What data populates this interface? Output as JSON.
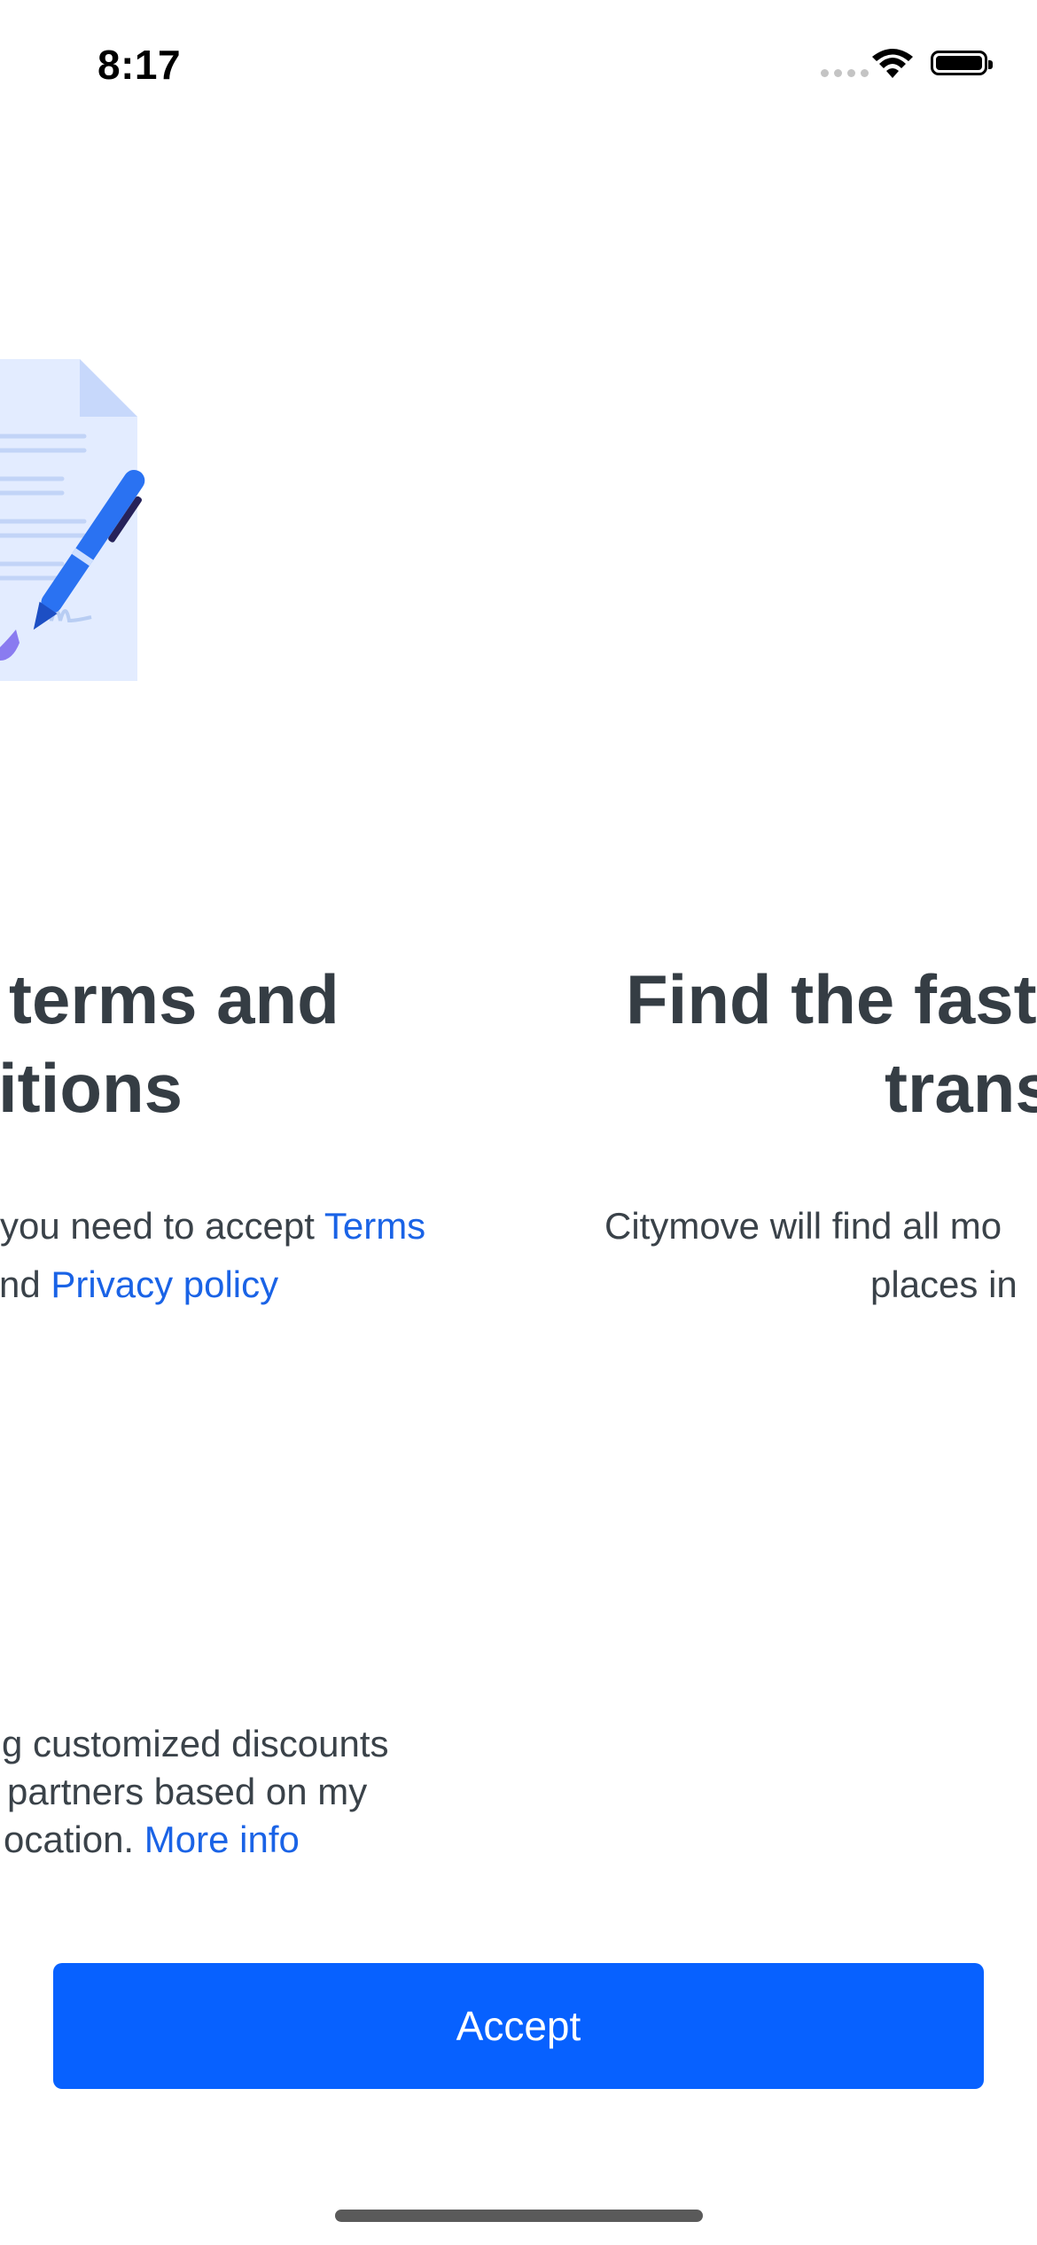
{
  "status_bar": {
    "time": "8:17",
    "icons": [
      "cellular-signal-icon",
      "wifi-icon",
      "battery-icon"
    ]
  },
  "slides": [
    {
      "illustration": "document-with-pen-illustration",
      "heading_line1": "terms and",
      "heading_line2": "itions",
      "body_prefix_1": "you need to accept ",
      "body_link_1": "Terms",
      "body_prefix_2": "nd ",
      "body_link_2": "Privacy policy"
    },
    {
      "heading_line1": "Find the fast",
      "heading_line2": "trans",
      "body_line1": "Citymove will find all mo",
      "body_line2": "places in"
    }
  ],
  "consent": {
    "line1": "g customized discounts",
    "line2": "partners based on my",
    "line3_prefix": "ocation. ",
    "more_info_link": "More info"
  },
  "accept_button": {
    "label": "Accept"
  },
  "colors": {
    "accent": "#0761ff",
    "link": "#1a63e6",
    "heading": "#353d44",
    "text": "#3a4249"
  }
}
